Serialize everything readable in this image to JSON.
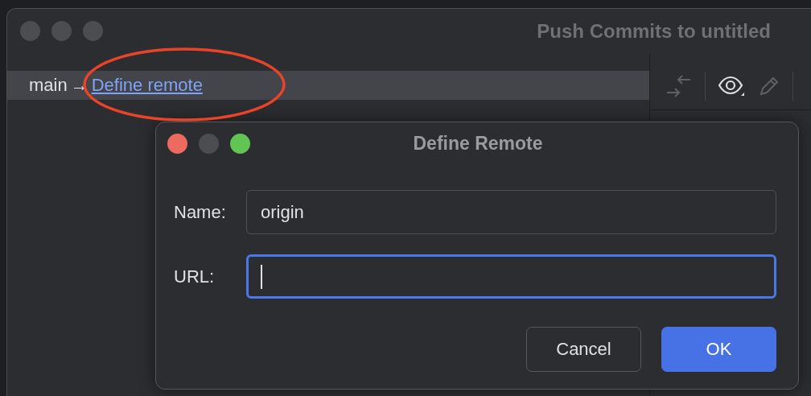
{
  "window": {
    "title": "Push Commits to untitled"
  },
  "branch_row": {
    "branch": "main",
    "arrow": "→",
    "link": "Define remote",
    "selected": true
  },
  "dialog": {
    "title": "Define Remote",
    "fields": [
      {
        "label": "Name:",
        "value": "origin",
        "focused": false
      },
      {
        "label": "URL:",
        "focused": true
      }
    ],
    "buttons": [
      {
        "label": "Cancel",
        "kind": "secondary"
      },
      {
        "label": "OK",
        "kind": "primary"
      }
    ]
  }
}
